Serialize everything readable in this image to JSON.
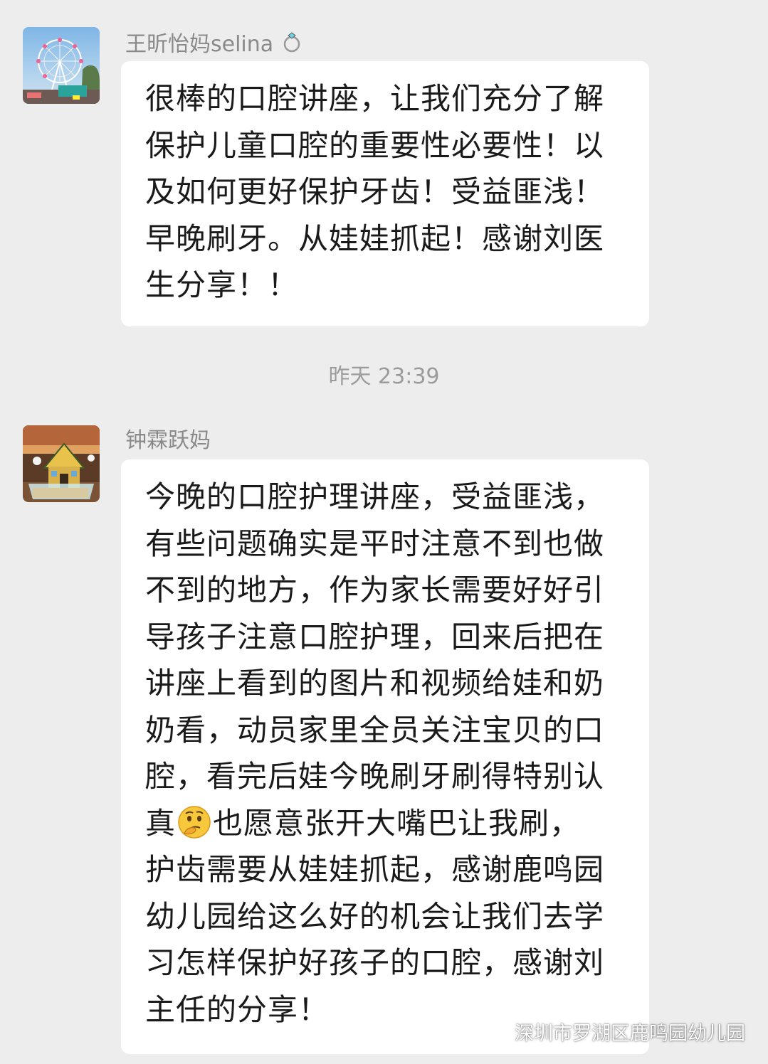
{
  "messages": [
    {
      "sender": "王昕怡妈selina",
      "sender_icon": "ring-icon",
      "avatar": "ferris-wheel-photo",
      "lines": [
        "很棒的口腔讲座，让我们充分了解",
        "保护儿童口腔的重要性必要性！以",
        "及如何更好保护牙齿！受益匪浅！",
        "早晚刷牙。从娃娃抓起！感谢刘医",
        "生分享！！"
      ]
    },
    {
      "sender": "钟霖跃妈",
      "avatar": "gingerbread-house-photo",
      "lines": [
        "今晚的口腔护理讲座，受益匪浅，",
        "有些问题确实是平时注意不到也做",
        "不到的地方，作为家长需要好好引",
        "导孩子注意口腔护理，回来后把在",
        "讲座上看到的图片和视频给娃和奶",
        "奶看，动员家里全员关注宝贝的口",
        "腔，看完后娃今晚刷牙刷得特别认"
      ],
      "line8_before": "真",
      "line8_emoji": "thinking-face-emoji",
      "line8_after": "也愿意张开大嘴巴让我刷，",
      "lines_after": [
        "护齿需要从娃娃抓起，感谢鹿鸣园",
        "幼儿园给这么好的机会让我们去学",
        "习怎样保护好孩子的口腔，感谢刘",
        "主任的分享！"
      ]
    }
  ],
  "timestamp": "昨天 23:39",
  "watermark": "深圳市罗湖区鹿鸣园幼儿园",
  "watermark_icon": "wechat-official-account-icon",
  "colors": {
    "background": "#ededed",
    "bubble": "#ffffff",
    "sender_text": "#8a8a8a",
    "timestamp_text": "#9b9b9b",
    "message_text": "#1a1a1a"
  }
}
